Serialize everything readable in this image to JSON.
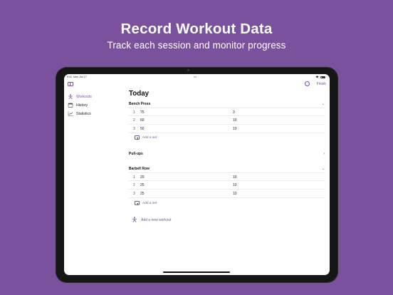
{
  "hero": {
    "title": "Record Workout Data",
    "subtitle": "Track each session and monitor progress"
  },
  "status_bar": {
    "time": "9:41",
    "date": "Mon Jun 17",
    "dots": "•••"
  },
  "sidebar": {
    "items": [
      {
        "label": "Workouts",
        "icon": "figure-icon",
        "active": true
      },
      {
        "label": "History",
        "icon": "calendar-icon",
        "active": false
      },
      {
        "label": "Statistics",
        "icon": "chart-icon",
        "active": false
      }
    ]
  },
  "toolbar": {
    "more_icon": "ellipsis-circle-icon",
    "finish_label": "Finish"
  },
  "main": {
    "title": "Today",
    "add_set_label": "Add a set",
    "add_workout_label": "Add a new workout",
    "workouts": [
      {
        "name": "Bench Press",
        "expanded": true,
        "sets": [
          {
            "num": "1",
            "weight": "75",
            "reps": "3"
          },
          {
            "num": "2",
            "weight": "60",
            "reps": "10"
          },
          {
            "num": "3",
            "weight": "50",
            "reps": "10"
          }
        ]
      },
      {
        "name": "Pull-ups",
        "expanded": false,
        "sets": []
      },
      {
        "name": "Barbell Row",
        "expanded": true,
        "sets": [
          {
            "num": "1",
            "weight": "20",
            "reps": "10"
          },
          {
            "num": "2",
            "weight": "25",
            "reps": "10"
          },
          {
            "num": "3",
            "weight": "25",
            "reps": "10"
          }
        ]
      }
    ]
  },
  "colors": {
    "background": "#7a519c",
    "accent": "#7a519c"
  }
}
